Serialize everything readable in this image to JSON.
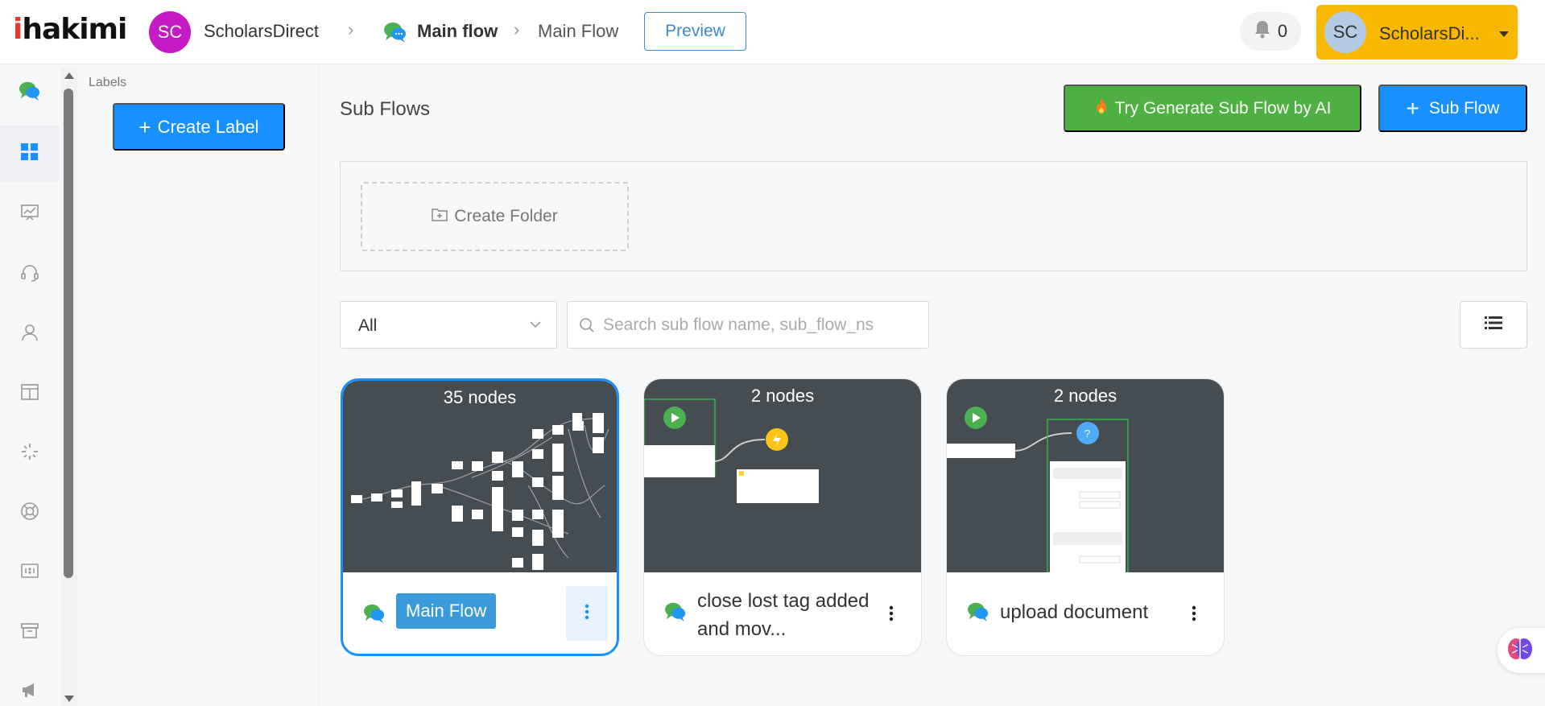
{
  "header": {
    "logo_text": "hakimi",
    "logo_i": "i",
    "workspace_initials": "SC",
    "workspace_name": "ScholarsDirect",
    "breadcrumb_main": "Main flow",
    "breadcrumb_sub": "Main Flow",
    "preview_label": "Preview",
    "notification_count": "0",
    "user_initials": "SC",
    "user_name": "ScholarsDi..."
  },
  "sidebar": {
    "items": [
      {
        "icon": "chat-flow-icon"
      },
      {
        "icon": "dashboard-grid-icon"
      },
      {
        "icon": "analytics-icon"
      },
      {
        "icon": "headset-icon"
      },
      {
        "icon": "user-icon"
      },
      {
        "icon": "layout-icon"
      },
      {
        "icon": "loading-icon"
      },
      {
        "icon": "lifebuoy-icon"
      },
      {
        "icon": "ratio-icon"
      },
      {
        "icon": "archive-icon"
      },
      {
        "icon": "megaphone-icon"
      }
    ]
  },
  "labels": {
    "title": "Labels",
    "create_label": "Create Label"
  },
  "main": {
    "title": "Sub Flows",
    "ai_button": "Try Generate Sub Flow by AI",
    "sub_flow_button": "Sub Flow",
    "create_folder": "Create Folder",
    "filter_value": "All",
    "search_placeholder": "Search sub flow name, sub_flow_ns"
  },
  "cards": [
    {
      "nodes": "35 nodes",
      "name": "Main Flow",
      "selected": true
    },
    {
      "nodes": "2 nodes",
      "name": "close lost tag added and mov..."
    },
    {
      "nodes": "2 nodes",
      "name": "upload document"
    }
  ],
  "colors": {
    "primary": "#1890ff",
    "ai_green": "#4db040",
    "user_button": "#f9b800",
    "workspace_avatar": "#c619c6",
    "card_preview_bg": "#454c52"
  }
}
